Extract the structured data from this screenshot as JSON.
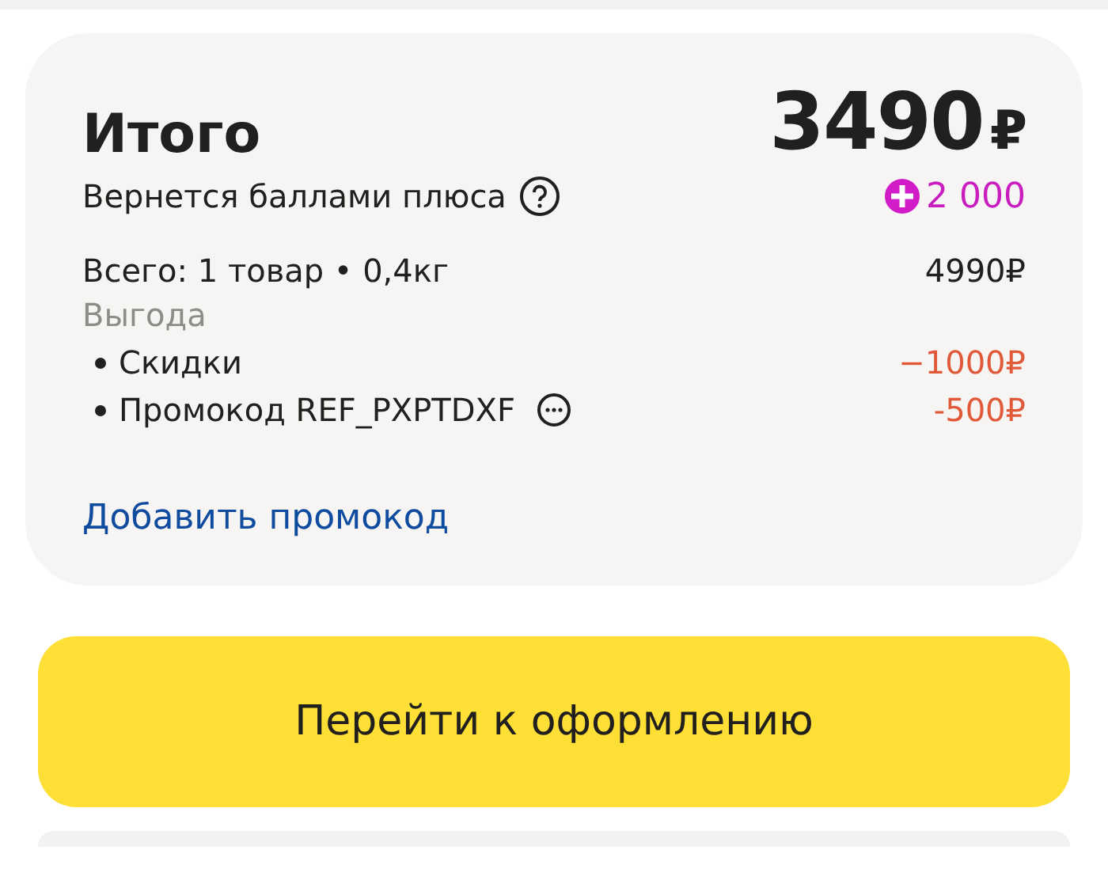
{
  "summary": {
    "title": "Итого",
    "amount": "3490",
    "currency": "₽",
    "cashback_label": "Вернется баллами плюса",
    "cashback_points": "2 000",
    "total_line": {
      "label": "Всего: 1 товар • 0,4кг",
      "value": "4990₽"
    },
    "benefit": {
      "label": "Выгода",
      "items": [
        {
          "kind": "discount",
          "label": "Скидки",
          "value": "−1000₽"
        },
        {
          "kind": "promo",
          "label": "Промокод REF_PXPTDXF",
          "value": "-500₽"
        }
      ]
    },
    "add_promo_link": "Добавить промокод"
  },
  "checkout_button": "Перейти к оформлению"
}
